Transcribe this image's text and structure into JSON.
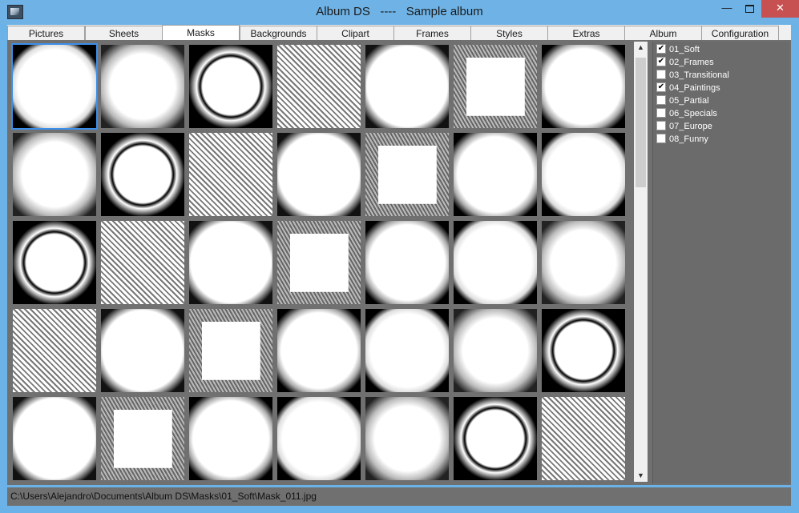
{
  "window": {
    "title": "Album DS   ----   Sample album"
  },
  "tabs": [
    {
      "label": "Pictures"
    },
    {
      "label": "Sheets"
    },
    {
      "label": "Masks"
    },
    {
      "label": "Backgrounds"
    },
    {
      "label": "Clipart"
    },
    {
      "label": "Frames"
    },
    {
      "label": "Styles"
    },
    {
      "label": "Extras"
    },
    {
      "label": "Album"
    },
    {
      "label": "Configuration"
    }
  ],
  "active_tab": "Masks",
  "mask_grid": {
    "rows": 5,
    "cols": 7,
    "selected_index": 0,
    "visible_count": 35
  },
  "categories": [
    {
      "label": "01_Soft",
      "checked": true
    },
    {
      "label": "02_Frames",
      "checked": true
    },
    {
      "label": "03_Transitional",
      "checked": false
    },
    {
      "label": "04_Paintings",
      "checked": true
    },
    {
      "label": "05_Partial",
      "checked": false
    },
    {
      "label": "06_Specials",
      "checked": false
    },
    {
      "label": "07_Europe",
      "checked": false
    },
    {
      "label": "08_Funny",
      "checked": false
    }
  ],
  "status": {
    "path": "C:\\Users\\Alejandro\\Documents\\Album DS\\Masks\\01_Soft\\Mask_011.jpg"
  },
  "colors": {
    "titlebar": "#6fb3e6",
    "close": "#c75050",
    "panel": "#707070",
    "selection": "#3c8ee8"
  }
}
